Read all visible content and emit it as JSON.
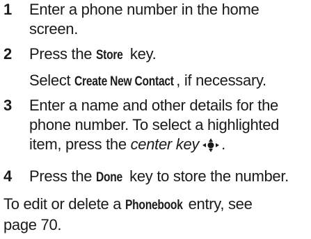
{
  "steps": [
    {
      "num": "1",
      "text": "Enter a phone number in the home screen."
    },
    {
      "num": "2",
      "pre": "Press the ",
      "kw": "Store",
      "post": " key."
    },
    {
      "pre": "Select ",
      "kw": "Create New Contact",
      "post": ", if necessary."
    },
    {
      "num": "3",
      "line1": "Enter a name and other details for the",
      "line2": "phone number. To select a highlighted",
      "line3_pre": "item, press the ",
      "line3_em": "center key",
      "line3_post": "."
    },
    {
      "num": "4",
      "pre": "Press the ",
      "kw": "Done",
      "post": " key to store the number."
    }
  ],
  "footer": {
    "pre": "To edit or delete a ",
    "kw": "Phonebook",
    "post": " entry, see",
    "line2": "page 70."
  },
  "icon": {
    "name": "center-key-icon"
  }
}
